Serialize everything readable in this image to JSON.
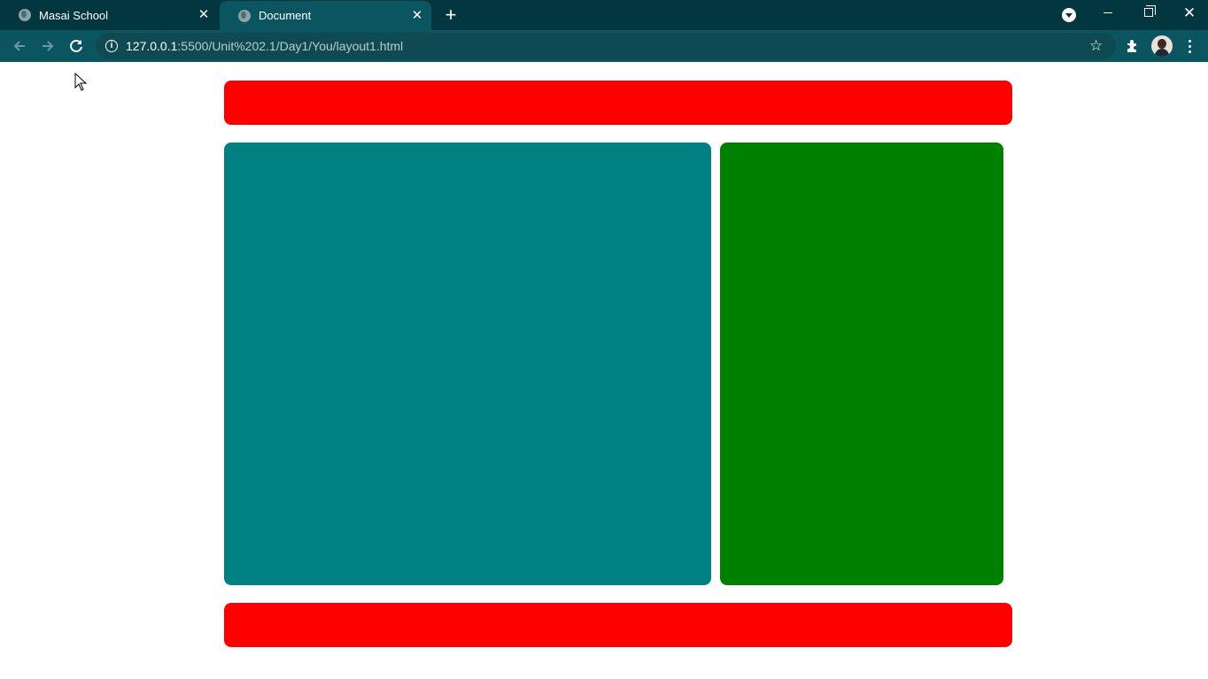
{
  "browser": {
    "tabs": [
      {
        "title": "Masai School",
        "active": false,
        "favicon": "globe-icon"
      },
      {
        "title": "Document",
        "active": true,
        "favicon": "globe-icon"
      }
    ],
    "url": {
      "host": "127.0.0.1",
      "rest": ":5500/Unit%202.1/Day1/You/layout1.html"
    },
    "icons": {
      "back": "arrow-left-icon",
      "forward": "arrow-right-icon",
      "reload": "reload-icon",
      "info": "info-icon",
      "star": "star-icon",
      "extensions": "puzzle-icon",
      "menu": "kebab-menu-icon"
    }
  },
  "page": {
    "blocks": [
      {
        "name": "header-block",
        "color": "#ff0000"
      },
      {
        "name": "main-block",
        "color": "#008080"
      },
      {
        "name": "side-block",
        "color": "#008000"
      },
      {
        "name": "footer-block",
        "color": "#ff0000"
      }
    ]
  },
  "theme": {
    "tabstrip": "#023740",
    "toolbar": "#0a5560"
  }
}
